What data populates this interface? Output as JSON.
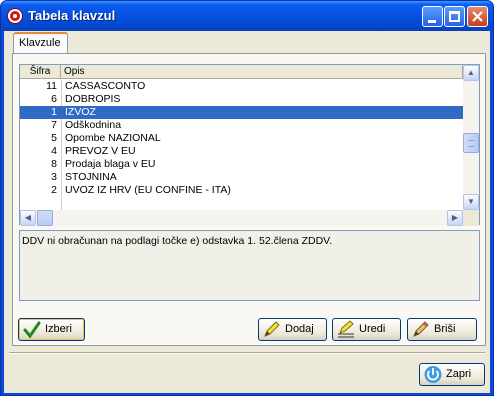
{
  "window": {
    "title": "Tabela klavzul"
  },
  "tabs": [
    {
      "label": "Klavzule"
    }
  ],
  "grid": {
    "columns": [
      "Šifra",
      "Opis"
    ],
    "rows": [
      {
        "sifra": "11",
        "opis": "CASSASCONTO"
      },
      {
        "sifra": "6",
        "opis": "DOBROPIS"
      },
      {
        "sifra": "1",
        "opis": "IZVOZ",
        "selected": true
      },
      {
        "sifra": "7",
        "opis": "Odškodnina"
      },
      {
        "sifra": "5",
        "opis": "Opombe NAZIONAL"
      },
      {
        "sifra": "4",
        "opis": "PREVOZ V EU"
      },
      {
        "sifra": "8",
        "opis": "Prodaja blaga v EU"
      },
      {
        "sifra": "3",
        "opis": "STOJNINA"
      },
      {
        "sifra": "2",
        "opis": "UVOZ IZ HRV (EU CONFINE - ITA)"
      }
    ]
  },
  "description": "DDV ni obračunan na podlagi točke e) odstavka 1. 52.člena ZDDV.",
  "buttons": {
    "izberi": "Izberi",
    "dodaj": "Dodaj",
    "uredi": "Uredi",
    "brisi": "Briši",
    "zapri": "Zapri"
  },
  "icons": {
    "app": "app-logo-icon",
    "izberi": "checkmark-icon",
    "dodaj": "pencil-add-icon",
    "uredi": "pencil-edit-icon",
    "brisi": "pencil-eraser-icon",
    "zapri": "power-icon"
  },
  "colors": {
    "titlebar": "#0650e0",
    "selection": "#316ac5",
    "face": "#ece9d8"
  }
}
